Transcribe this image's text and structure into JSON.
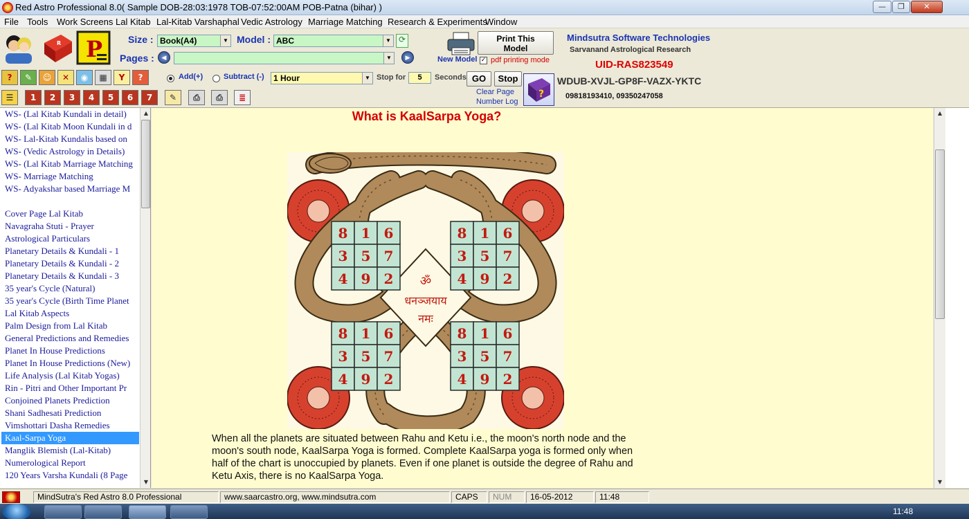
{
  "window": {
    "title": "Red Astro Professional 8.0( Sample DOB-28:03:1978 TOB-07:52:00AM POB-Patna (bihar) )",
    "controls": {
      "minimize": "—",
      "maximize": "❐",
      "close": "✕"
    }
  },
  "menu": [
    "File",
    "Tools",
    "Work Screens",
    "Lal Kitab",
    "Lal-Kitab Varshaphal",
    "Vedic Astrology",
    "Marriage Matching",
    "Research & Experiments",
    "Window"
  ],
  "toolbar": {
    "size_label": "Size :",
    "size_value": "Book(A4)",
    "model_label": "Model :",
    "model_value": "ABC",
    "pages_label": "Pages :",
    "pages_value": "",
    "new_model_label": "New Model",
    "print_btn_line1": "Print This",
    "print_btn_line2": "Model",
    "pdf_label": "pdf printing mode",
    "pdf_checked": true,
    "add_label": "Add(+)",
    "subtract_label": "Subtract (-)",
    "add_selected": true,
    "interval_value": "1 Hour",
    "stop_for_label": "Stop for",
    "stop_for_value": "5",
    "seconds_label": "Seconds",
    "go_label": "GO",
    "stop_label": "Stop",
    "clear_page_label": "Clear Page",
    "number_log_label": "Number Log",
    "numbered_icons": [
      "1",
      "2",
      "3",
      "4",
      "5",
      "6",
      "7"
    ]
  },
  "company": {
    "name": "Mindsutra Software Technologies",
    "subtitle": "Sarvanand Astrological Research",
    "uid": "UID-RAS823549",
    "key": "WDUB-XVJL-GP8F-VAZX-YKTC",
    "phones": "09818193410, 09350247058"
  },
  "sidebar": {
    "items": [
      "WS- (Lal Kitab Kundali in detail)",
      "WS- (Lal Kitab Moon Kundali in d",
      "WS- Lal-Kitab Kundalis based on",
      "WS- (Vedic Astrology in Details)",
      "WS- (Lal Kitab Marriage Matching",
      "WS- Marriage Matching",
      "WS- Adyakshar based Marriage M",
      "",
      "Cover Page Lal Kitab",
      "Navagraha Stuti - Prayer",
      "Astrological Particulars",
      "Planetary Details & Kundali - 1",
      "Planetary Details & Kundali - 2",
      "Planetary Details & Kundali - 3",
      "35 year's Cycle (Natural)",
      "35 year's Cycle (Birth Time Planet",
      "Lal Kitab Aspects",
      "Palm Design from Lal Kitab",
      "General Predictions and Remedies",
      "Planet In House Predictions",
      "Planet In House Predictions (New)",
      "Life Analysis (Lal Kitab Yogas)",
      "Rin - Pitri and Other Important Pr",
      "Conjoined Planets Prediction",
      "Shani Sadhesati Prediction",
      "Vimshottari Dasha Remedies",
      "Kaal-Sarpa Yoga",
      "Manglik Blemish (Lal-Kitab)",
      "Numerological Report",
      "120 Years Varsha Kundali (8 Page"
    ],
    "selected_index": 26
  },
  "content": {
    "title": "What is KaalSarpa Yoga?",
    "om": "ॐ",
    "mantra1": "धनञ्जयाय",
    "mantra2": "नमः",
    "magic_square": [
      "8",
      "1",
      "6",
      "3",
      "5",
      "7",
      "4",
      "9",
      "2"
    ],
    "paragraph": "When all the planets are situated between Rahu and Ketu i.e., the moon's north node and the moon's south node, KaalSarpa Yoga is formed. Complete KaalSarpa yoga is formed only when half of the chart is unoccupied by planets. Even if one planet is outside the degree of Rahu and Ketu Axis, there is no KaalSarpa Yoga."
  },
  "status": {
    "app": "MindSutra's Red Astro 8.0 Professional",
    "website": "www.saarcastro.org, www.mindsutra.com",
    "caps": "CAPS",
    "num": "NUM",
    "date": "16-05-2012",
    "time": "11:48"
  },
  "taskbar": {
    "clock": "11:48"
  },
  "colors": {
    "content_bg": "#fffccf",
    "title_red": "#d40000",
    "combo_green": "#c8f7c5",
    "selection": "#3399ff",
    "snake": "#b08a5a",
    "square_cell": "#c2e5d3",
    "flower": "#d6412e"
  }
}
